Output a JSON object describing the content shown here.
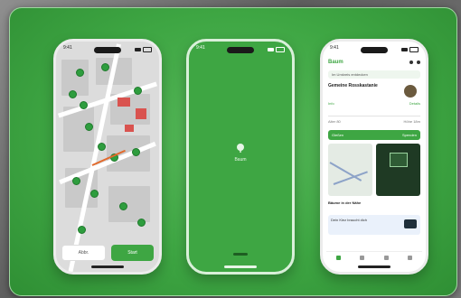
{
  "phone1": {
    "time": "9:41",
    "cancel_label": "Abbr.",
    "confirm_label": "Start"
  },
  "phone2": {
    "time": "9:41",
    "app_name": "Baum"
  },
  "phone3": {
    "time": "9:41",
    "app_name": "Baum",
    "search_text": "Im Umkreis entdecken",
    "tree_title": "Gemeine Rosskastanie",
    "tree_left": "Info",
    "tree_right": "Details",
    "stat_left": "Alter 80",
    "stat_right": "Höhe 18m",
    "bar_left": "Gießen",
    "bar_right": "Spenden",
    "tile_caption": "Bäume in der Nähe",
    "info_text": "Dein Kiez braucht dich"
  },
  "colors": {
    "brand_green": "#3ea643",
    "building_red": "#d9534f",
    "route_orange": "#e26a2c"
  }
}
